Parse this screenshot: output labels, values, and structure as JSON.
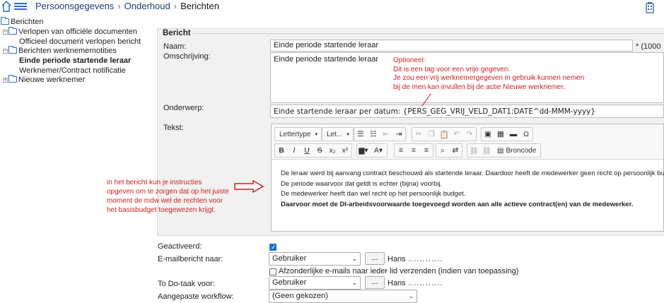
{
  "breadcrumb": {
    "items": [
      "Persoonsgegevens",
      "Onderhoud",
      "Berichten"
    ]
  },
  "tree": {
    "root": "Berichten",
    "group1": "Verlopen van officiële documenten",
    "group1_child": "Officieel document verlopen bericht",
    "group2": "Berichten werknemernotities",
    "group2_child_selected": "Einde periode startende leraar",
    "group2_child2": "Werknemer/Contract notificatie",
    "group3": "Nieuwe werknemer"
  },
  "form": {
    "section_title": "Bericht",
    "naam_label": "Naam:",
    "naam_value": "Einde periode startende leraar",
    "naam_suffix": "* (1000",
    "omschrijving_label": "Omschrijving:",
    "omschrijving_value": "Einde periode startende leraar",
    "onderwerp_label": "Onderwerp:",
    "onderwerp_value": "Einde startende leraar per datum: {PERS_GEG_VRIJ_VELD_DAT1:DATE^dd-MMM-yyyy}",
    "tekst_label": "Tekst:",
    "geactiveerd_label": "Geactiveerd:",
    "email_label": "E-mailbericht naar:",
    "email_select": "Gebruiker",
    "email_user": "Hans",
    "afzonderlijk_label": "Afzonderlijke e-mails naar ieder lid verzenden (indien van toepassing)",
    "todo_label": "To Do-taak voor:",
    "todo_select": "Gebruiker",
    "todo_user": "Hans",
    "workflow_label": "Aangepaste workflow:",
    "workflow_select": "(Geen gekozen)",
    "dots_label": "..."
  },
  "toolbar": {
    "font_dropdown": "Lettertype",
    "size_dropdown": "Let...",
    "bold": "B",
    "italic": "I",
    "underline": "U",
    "strike": "S",
    "subscript": "x₂",
    "superscript": "x²",
    "omega": "Ω",
    "broncode": "Broncode"
  },
  "editor": {
    "lines": [
      "De leraar werd bij aanvang contract beschouwd als startende leraar. Daardoor heeft de medewerker geen recht op persoonlijk budget",
      "De periode waarvoor dat geldt is echter (bijna) voorbij.",
      "De medewerker heeft dan wel recht op het persoonlijk budget.",
      "Daarvoor moet de DI-arbeidsvoorwaarde toegevoegd worden aan alle actieve contract(en) van de medewerker."
    ]
  },
  "annotations": {
    "optioneel": [
      "Optioneel:",
      "Dit is een tag voor een vrije gegeven.",
      "Je zou een vrij werknemergegeven in gebruik kunnen nemen",
      "bij de men kan invullen bij de actie Nieuwe werknemer."
    ],
    "instructies": [
      "in het bericht kun  je instructies",
      "opgeven om te zorgen dat op het juiste",
      "moment de mdw wel de rechten voor",
      "het basisbudget toegewezen krijgt."
    ],
    "color": "#d21f1f"
  },
  "colors": {
    "accent": "#2b6cc7",
    "checkbox": "#1a6fd8",
    "panel_bg": "#f1f1f1"
  }
}
